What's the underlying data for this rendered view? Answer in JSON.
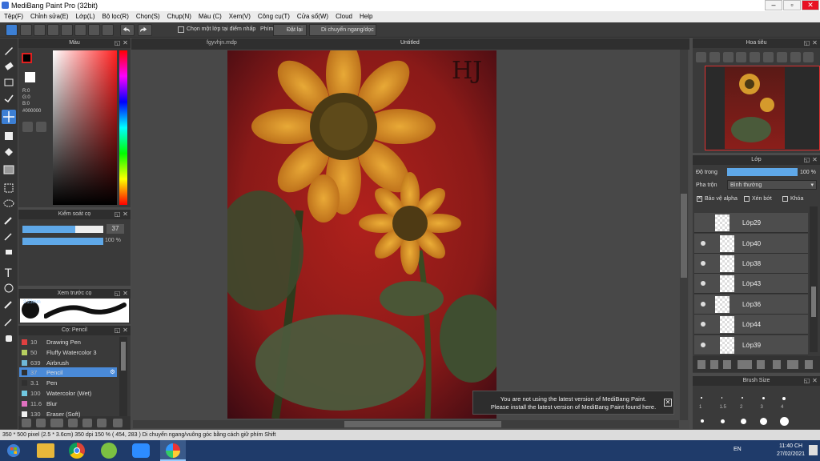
{
  "window": {
    "title": "MediBang Paint Pro (32bit)"
  },
  "menu": [
    "Tệp(F)",
    "Chỉnh sửa(E)",
    "Lớp(L)",
    "Bộ lọc(R)",
    "Chọn(S)",
    "Chụp(N)",
    "Màu (C)",
    "Xem(V)",
    "Công cụ(T)",
    "Cửa sổ(W)",
    "Cloud",
    "Help"
  ],
  "toolbar": {
    "checkbox_label": "Chọn một lớp tại điểm nhấp",
    "snap_label": "Phím",
    "reset_label": "Đặt lại",
    "move_label": "Di chuyển ngang/dọc"
  },
  "color_panel": {
    "title": "Màu",
    "r": "R:0",
    "g": "G:0",
    "b": "B:0",
    "hex": "#000000",
    "accent": "#e02020"
  },
  "brush_control": {
    "title": "Kiểm soát cọ",
    "size": "37",
    "opacity": "100 %",
    "size_fraction": 0.65,
    "opacity_fraction": 1.0
  },
  "preview": {
    "title": "Xem trước cọ",
    "size_label": "2.23mm"
  },
  "brush_list": {
    "title": "Cọ: Pencil",
    "items": [
      {
        "size": "10",
        "name": "Drawing Pen",
        "color": "#e04040"
      },
      {
        "size": "50",
        "name": "Fluffy Watercolor 3",
        "color": "#b8d060"
      },
      {
        "size": "639",
        "name": "Airbrush",
        "color": "#6fb8d8"
      },
      {
        "size": "37",
        "name": "Pencil",
        "color": "#303030",
        "selected": true
      },
      {
        "size": "3.1",
        "name": "Pen",
        "color": "#303030"
      },
      {
        "size": "100",
        "name": "Watercolor (Wet)",
        "color": "#70c8e0"
      },
      {
        "size": "11.6",
        "name": "Blur",
        "color": "#e070c0"
      },
      {
        "size": "130",
        "name": "Eraser (Soft)",
        "color": "#f0f0f0"
      }
    ]
  },
  "tabs": [
    "fgyvhjn.mdp",
    "Untitled"
  ],
  "canvas": {
    "signature": "HJ"
  },
  "notice": {
    "line1": "You are not using the latest version of MediBang Paint.",
    "line2": "Please install the latest version of MediBang Paint found here."
  },
  "navigator": {
    "title": "Hoa tiêu"
  },
  "layers": {
    "title": "Lớp",
    "opacity_label": "Độ trong",
    "opacity_value": "100 %",
    "blend_label": "Pha trộn",
    "blend_value": "Bình thường",
    "protect_alpha": "Bảo vệ alpha",
    "clipping": "Xén bớt",
    "lock": "Khóa",
    "rows": [
      "Lớp29",
      "Lớp40",
      "Lớp38",
      "Lớp43",
      "Lớp36",
      "Lớp44",
      "Lớp39"
    ]
  },
  "brush_size": {
    "title": "Brush Size",
    "labels": [
      "1",
      "1.5",
      "2",
      "3",
      "4"
    ]
  },
  "status": {
    "text": "350 * 500 pixel  (2.5 * 3.6cm)  350 dpi  150 %  ( 454, 283 )  Di chuyển ngang/vuông góc bằng cách giữ phím Shift"
  },
  "taskbar": {
    "lang": "EN",
    "time": "11:40 CH",
    "date": "27/02/2021"
  }
}
